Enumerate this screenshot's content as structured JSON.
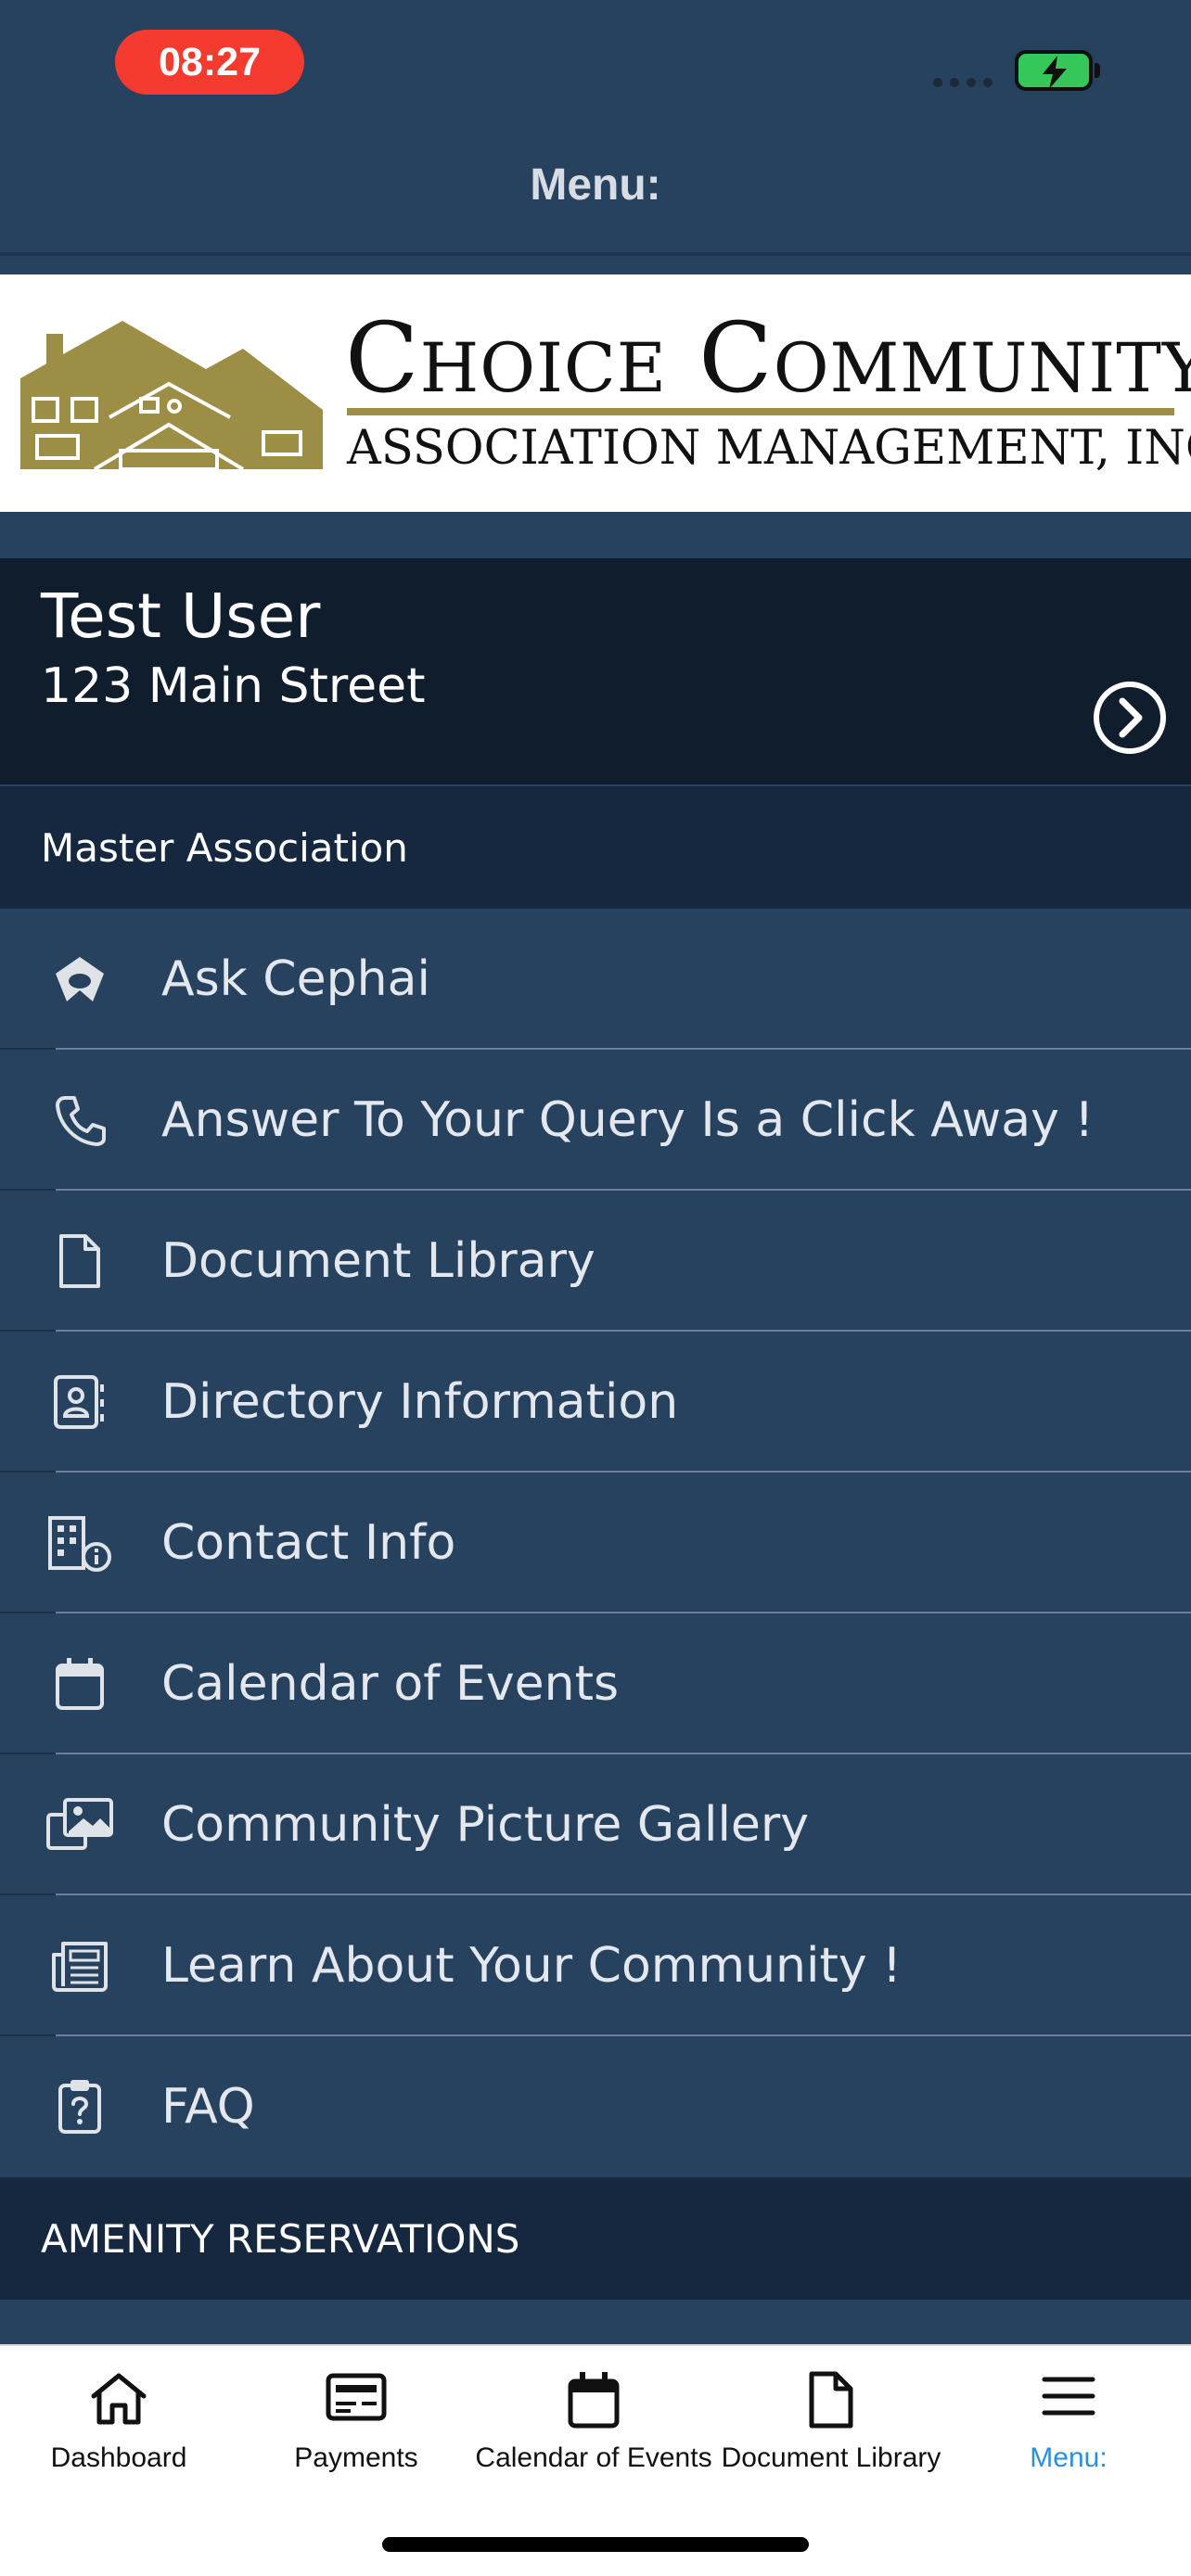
{
  "status": {
    "time": "08:27"
  },
  "nav": {
    "title": "Menu:"
  },
  "logo": {
    "line1": "Choice Community",
    "line2": "ASSOCIATION MANAGEMENT, INC.",
    "color": "#9d8e46"
  },
  "user": {
    "name": "Test User",
    "address": "123 Main Street"
  },
  "sections": {
    "master": "Master Association",
    "amenity": "AMENITY RESERVATIONS"
  },
  "menu": {
    "items": [
      {
        "label": "Ask Cephai",
        "icon": "cephai-logo-icon"
      },
      {
        "label": "Answer To Your Query Is a Click Away !",
        "icon": "phone-icon"
      },
      {
        "label": "Document Library",
        "icon": "document-icon"
      },
      {
        "label": "Directory Information",
        "icon": "contact-card-icon"
      },
      {
        "label": "Contact Info",
        "icon": "building-info-icon"
      },
      {
        "label": "Calendar of Events",
        "icon": "calendar-icon"
      },
      {
        "label": "Community Picture Gallery",
        "icon": "images-icon"
      },
      {
        "label": "Learn About Your Community !",
        "icon": "newspaper-icon"
      },
      {
        "label": "FAQ",
        "icon": "clipboard-question-icon"
      }
    ]
  },
  "tabs": [
    {
      "label": "Dashboard",
      "icon": "home-icon"
    },
    {
      "label": "Payments",
      "icon": "payments-icon"
    },
    {
      "label": "Calendar of Events",
      "icon": "calendar-icon"
    },
    {
      "label": "Document Library",
      "icon": "document-icon"
    },
    {
      "label": "Menu:",
      "icon": "hamburger-icon",
      "active": true
    }
  ],
  "colors": {
    "background": "#26425f",
    "sectionHeader": "#152840",
    "userCard": "#0f1d2c",
    "activeTab": "#2a8fe0",
    "timePill": "#f53a30"
  }
}
